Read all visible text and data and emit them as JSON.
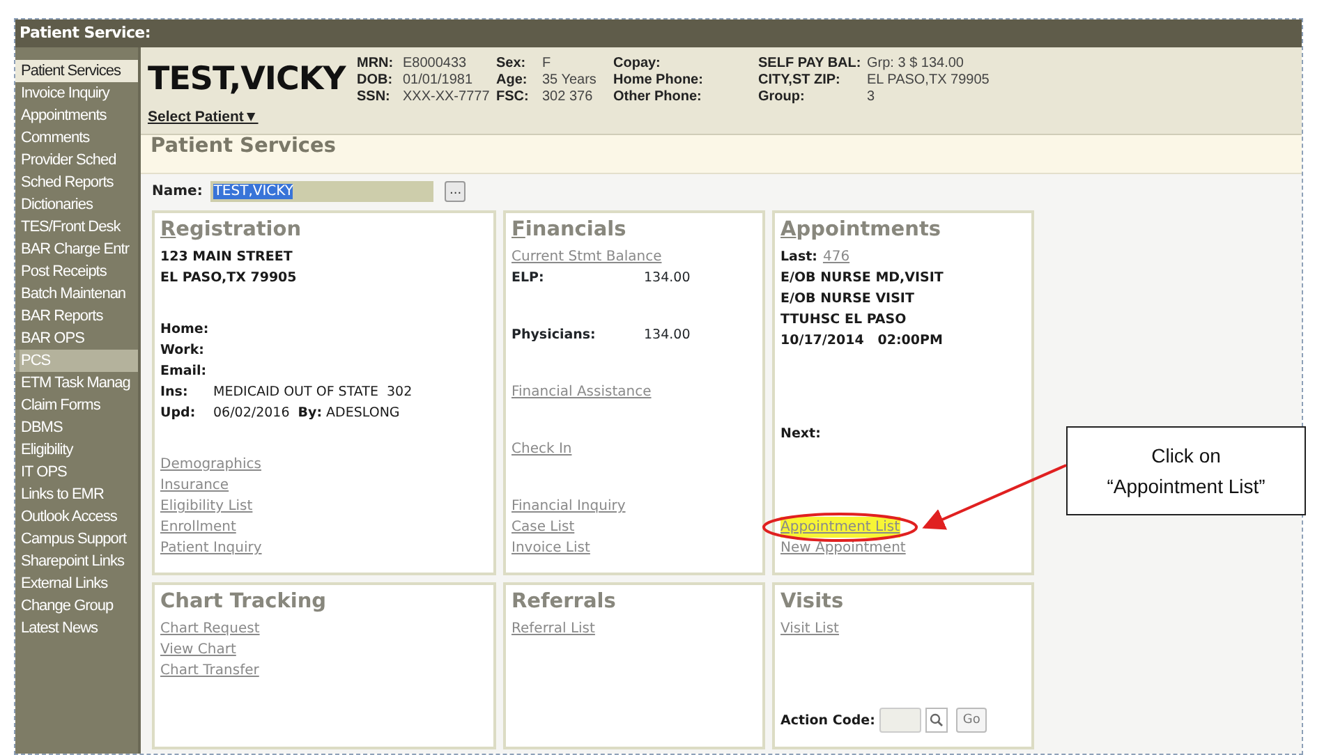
{
  "window": {
    "title": "Patient Service:"
  },
  "sidebar": {
    "items": [
      {
        "label": "Patient Services",
        "selected": true,
        "highlighted": false
      },
      {
        "label": "Invoice Inquiry",
        "selected": false,
        "highlighted": false
      },
      {
        "label": "Appointments",
        "selected": false,
        "highlighted": false
      },
      {
        "label": "Comments",
        "selected": false,
        "highlighted": false
      },
      {
        "label": "Provider Sched",
        "selected": false,
        "highlighted": false
      },
      {
        "label": "Sched Reports",
        "selected": false,
        "highlighted": false
      },
      {
        "label": "Dictionaries",
        "selected": false,
        "highlighted": false
      },
      {
        "label": "TES/Front Desk",
        "selected": false,
        "highlighted": false
      },
      {
        "label": "BAR Charge Entr",
        "selected": false,
        "highlighted": false
      },
      {
        "label": "Post Receipts",
        "selected": false,
        "highlighted": false
      },
      {
        "label": "Batch Maintenan",
        "selected": false,
        "highlighted": false
      },
      {
        "label": "BAR Reports",
        "selected": false,
        "highlighted": false
      },
      {
        "label": "BAR OPS",
        "selected": false,
        "highlighted": false
      },
      {
        "label": "PCS",
        "selected": false,
        "highlighted": true
      },
      {
        "label": "ETM Task Manag",
        "selected": false,
        "highlighted": false
      },
      {
        "label": "Claim Forms",
        "selected": false,
        "highlighted": false
      },
      {
        "label": "DBMS",
        "selected": false,
        "highlighted": false
      },
      {
        "label": "Eligibility",
        "selected": false,
        "highlighted": false
      },
      {
        "label": "IT OPS",
        "selected": false,
        "highlighted": false
      },
      {
        "label": "Links to EMR",
        "selected": false,
        "highlighted": false
      },
      {
        "label": "Outlook Access",
        "selected": false,
        "highlighted": false
      },
      {
        "label": "Campus Support",
        "selected": false,
        "highlighted": false
      },
      {
        "label": "Sharepoint Links",
        "selected": false,
        "highlighted": false
      },
      {
        "label": "External Links",
        "selected": false,
        "highlighted": false
      },
      {
        "label": "Change Group",
        "selected": false,
        "highlighted": false
      },
      {
        "label": "Latest News",
        "selected": false,
        "highlighted": false
      }
    ]
  },
  "header": {
    "patient_name": "TEST,VICKY",
    "select_patient": "Select Patient",
    "select_caret": "▼",
    "columns": [
      [
        {
          "label": "MRN:",
          "value": "E8000433"
        },
        {
          "label": "DOB:",
          "value": "01/01/1981"
        },
        {
          "label": "SSN:",
          "value": "XXX-XX-7777"
        }
      ],
      [
        {
          "label": "Sex:",
          "value": "F"
        },
        {
          "label": "Age:",
          "value": "35 Years"
        },
        {
          "label": "FSC:",
          "value": "302 376"
        }
      ],
      [
        {
          "label": "Copay:"
        },
        {
          "label": "Home Phone:"
        },
        {
          "label": "Other Phone:"
        }
      ],
      [
        {
          "label": "SELF PAY BAL:",
          "value": "Grp: 3 $ 134.00"
        },
        {
          "label": "CITY,ST ZIP:",
          "value": "EL PASO,TX 79905"
        },
        {
          "label": "Group:",
          "value": "3"
        }
      ]
    ]
  },
  "page_title": "Patient Services",
  "name_field": {
    "label": "Name:",
    "value": "TEST,VICKY",
    "text_selected": true,
    "button": "..."
  },
  "panels": [
    {
      "title": "Registration",
      "accesskey_underlined": true,
      "sections": [
        [
          {
            "kind": "text",
            "text": "123 MAIN STREET"
          },
          {
            "kind": "text",
            "text": "EL PASO,TX 79905"
          }
        ],
        [
          {
            "kind": "field",
            "label": "Home:"
          },
          {
            "kind": "field",
            "label": "Work:"
          },
          {
            "kind": "field",
            "label": "Email:"
          },
          {
            "kind": "field",
            "label": "Ins:",
            "value": "MEDICAID OUT OF STATE  302"
          },
          {
            "kind": "field",
            "label": "Upd:",
            "value": "06/02/2016  **By:** ADESLONG"
          }
        ],
        [
          {
            "kind": "link",
            "text": "Demographics"
          },
          {
            "kind": "link",
            "text": "Insurance"
          },
          {
            "kind": "link",
            "text": "Eligibility List"
          },
          {
            "kind": "link",
            "text": "Enrollment"
          },
          {
            "kind": "link",
            "text": "Patient Inquiry"
          }
        ]
      ]
    },
    {
      "title": "Financials",
      "accesskey_underlined": true,
      "sections": [
        [
          {
            "kind": "link",
            "text": "Current Stmt Balance"
          },
          {
            "kind": "amount",
            "label": "ELP:",
            "value": "134.00"
          }
        ],
        [
          {
            "kind": "amount",
            "label": "Physicians:",
            "value": "134.00"
          }
        ],
        [
          {
            "kind": "link",
            "text": "Financial Assistance"
          }
        ],
        [
          {
            "kind": "link",
            "text": "Check In"
          }
        ],
        [
          {
            "kind": "link",
            "text": "Financial Inquiry"
          },
          {
            "kind": "link",
            "text": "Case List"
          },
          {
            "kind": "link",
            "text": "Invoice List"
          }
        ]
      ]
    },
    {
      "title": "Appointments",
      "accesskey_underlined": true,
      "sections": [
        [
          {
            "kind": "field_link",
            "label": "Last:",
            "link": "476"
          },
          {
            "kind": "text",
            "text": "E/OB NURSE MD,VISIT"
          },
          {
            "kind": "text",
            "text": "E/OB NURSE VISIT"
          },
          {
            "kind": "text",
            "text": "TTUHSC EL PASO"
          },
          {
            "kind": "text",
            "text": "10/17/2014   02:00PM"
          }
        ],
        [
          {
            "kind": "field",
            "label": "Next:"
          }
        ],
        [
          {
            "kind": "link",
            "text": "Appointment List",
            "highlighted": true
          },
          {
            "kind": "link",
            "text": "New Appointment",
            "highlighted": false
          }
        ]
      ]
    },
    {
      "title": "Chart Tracking",
      "accesskey_underlined": false,
      "sections": [
        [
          {
            "kind": "link",
            "text": "Chart Request"
          },
          {
            "kind": "link",
            "text": "View Chart"
          },
          {
            "kind": "link",
            "text": "Chart Transfer"
          }
        ]
      ]
    },
    {
      "title": "Referrals",
      "accesskey_underlined": false,
      "sections": [
        [
          {
            "kind": "link",
            "text": "Referral List"
          }
        ]
      ]
    },
    {
      "title": "Visits",
      "accesskey_underlined": false,
      "sections": [
        [
          {
            "kind": "link",
            "text": "Visit List"
          }
        ],
        [
          {
            "kind": "action",
            "label": "Action Code:",
            "button": "Go"
          }
        ]
      ]
    }
  ],
  "annotation": {
    "lines": [
      "Click on",
      "“Appointment List”"
    ]
  }
}
